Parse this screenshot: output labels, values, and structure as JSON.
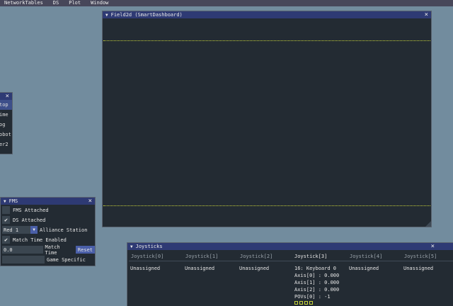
{
  "menubar": {
    "items": [
      "NetworkTables",
      "DS",
      "Plot",
      "Window"
    ]
  },
  "field_window": {
    "title": "Field2d (SmartDashboard)",
    "close": "×",
    "line_color": "#c7d23a"
  },
  "left_window": {
    "close": "×",
    "items": [
      "top",
      "ime",
      "og",
      "obot",
      "er2"
    ]
  },
  "fms_window": {
    "title": "FMS",
    "close": "×",
    "fms_attached": {
      "label": "FMS Attached",
      "checked": false
    },
    "ds_attached": {
      "label": "DS Attached",
      "checked": true
    },
    "alliance": {
      "value": "Red 1",
      "label": "Alliance Station"
    },
    "match_time_enabled": {
      "label": "Match Time Enabled",
      "checked": true
    },
    "match_time": {
      "value": "0.0",
      "label": "Match Time",
      "reset": "Reset"
    },
    "game_specific": {
      "value": "",
      "label": "Game Specific"
    }
  },
  "joysticks_window": {
    "title": "Joysticks",
    "close": "×",
    "columns": [
      "Joystick[0]",
      "Joystick[1]",
      "Joystick[2]",
      "Joystick[3]",
      "Joystick[4]",
      "Joystick[5]"
    ],
    "unassigned": "Unassigned",
    "j3": {
      "device": "16: Keyboard 0",
      "axis0": "Axis[0] : 0.000",
      "axis1": "Axis[1] : 0.000",
      "axis2": "Axis[2] : 0.000",
      "pov0": "POVs[0] : -1",
      "button_count": 4
    }
  }
}
